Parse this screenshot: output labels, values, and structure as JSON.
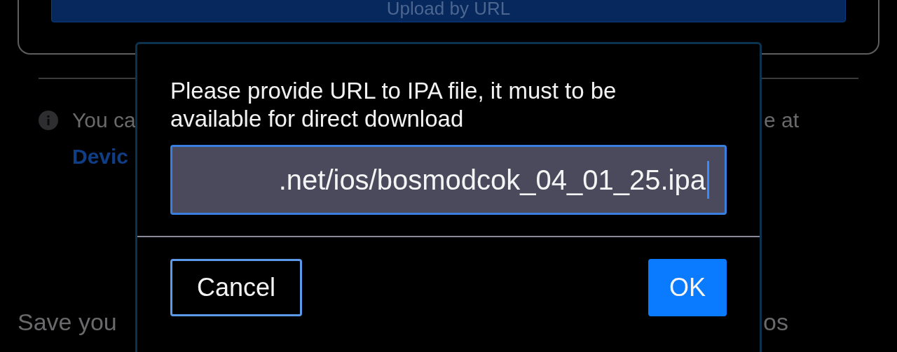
{
  "background": {
    "upload_button": "Upload by URL",
    "info_text_start": "You ca",
    "info_text_end": "e at",
    "link": "Devic",
    "save_text_start": "Save you",
    "save_text_end": "os"
  },
  "dialog": {
    "message": "Please provide URL to IPA file, it must to be available for direct download",
    "url_field": {
      "value": ".net/ios/bosmodcok_04_01_25.ipa"
    },
    "buttons": [
      {
        "label": "Cancel",
        "kind": "secondary"
      },
      {
        "label": "OK",
        "kind": "primary"
      }
    ]
  }
}
